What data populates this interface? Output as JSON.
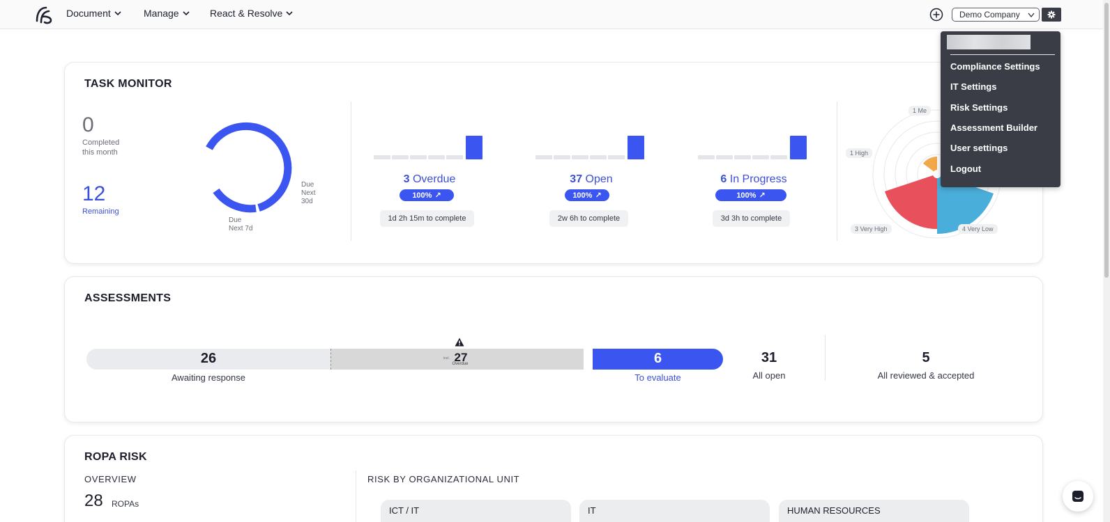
{
  "nav": {
    "items": [
      "Document",
      "Manage",
      "React & Resolve"
    ],
    "company": "Demo Company"
  },
  "menu": {
    "items": [
      "Compliance Settings",
      "IT Settings",
      "Risk Settings",
      "Assessment Builder",
      "User settings",
      "Logout"
    ]
  },
  "task_monitor": {
    "title": "TASK MONITOR",
    "completed": {
      "value": "0",
      "label": "Completed this month"
    },
    "remaining": {
      "value": "12",
      "label": "Remaining"
    },
    "donut_labels": {
      "next30": "Due Next 30d",
      "next7": "Due Next 7d"
    },
    "metrics": [
      {
        "count": "3",
        "label": "Overdue",
        "pill": "100%",
        "time": "1d 2h 15m to complete"
      },
      {
        "count": "37",
        "label": "Open",
        "pill": "100%",
        "time": "2w 6h to complete"
      },
      {
        "count": "6",
        "label": "In Progress",
        "pill": "100%",
        "time": "3d 3h to complete"
      }
    ],
    "radar_labels": {
      "medium": "1 Me",
      "high": "1 High",
      "very_high": "3 Very High",
      "very_low": "4 Very Low"
    },
    "colors": {
      "accent": "#3a55f0",
      "very_high": "#e8505b",
      "very_low": "#4aaedb",
      "medium": "#f0a84a"
    }
  },
  "assessments": {
    "title": "ASSESSMENTS",
    "awaiting": {
      "value": "26",
      "label": "Awaiting response"
    },
    "overdue": {
      "value": "27",
      "prefix": "incl.",
      "sub": "Overdue"
    },
    "to_evaluate": {
      "value": "6",
      "label": "To evaluate"
    },
    "all_open": {
      "value": "31",
      "label": "All open"
    },
    "reviewed": {
      "value": "5",
      "label": "All reviewed & accepted"
    }
  },
  "ropa": {
    "title": "ROPA RISK",
    "overview_label": "OVERVIEW",
    "count": "28",
    "count_unit": "ROPAs",
    "by_unit_label": "RISK BY ORGANIZATIONAL UNIT",
    "units": [
      "ICT / IT",
      "IT",
      "HUMAN RESOURCES"
    ]
  }
}
